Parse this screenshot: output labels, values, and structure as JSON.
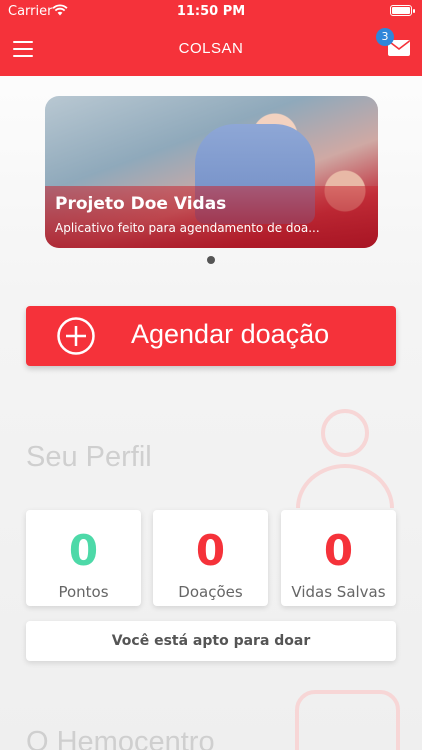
{
  "status_bar": {
    "carrier": "Carrier",
    "time": "11:50 PM"
  },
  "nav": {
    "title": "COLSAN",
    "badge_count": "3"
  },
  "banner": {
    "title": "Projeto Doe Vidas",
    "subtitle": "Aplicativo feito para agendamento de doa..."
  },
  "schedule_button": {
    "label": "Agendar doação"
  },
  "profile": {
    "title": "Seu Perfil",
    "stats": [
      {
        "value": "0",
        "label": "Pontos",
        "color": "#4dd9a8"
      },
      {
        "value": "0",
        "label": "Doações",
        "color": "#f5323a"
      },
      {
        "value": "0",
        "label": "Vidas Salvas",
        "color": "#f5323a"
      }
    ],
    "status": "Você está apto para doar"
  },
  "hemocentro": {
    "title": "O Hemocentro"
  },
  "colors": {
    "brand_red": "#f5323a",
    "badge_blue": "#2f86d9",
    "points_green": "#4dd9a8"
  }
}
